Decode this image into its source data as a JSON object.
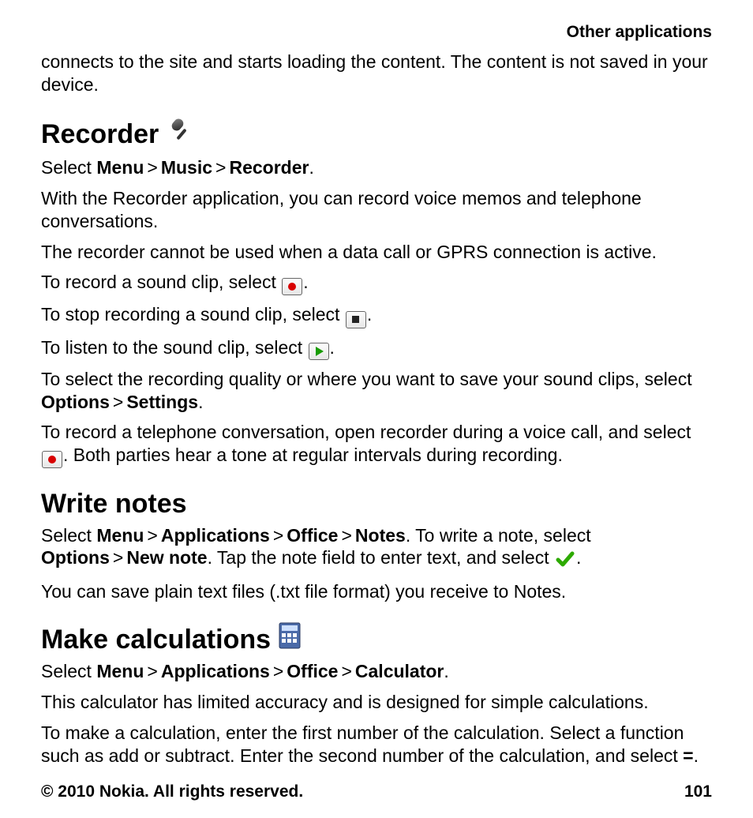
{
  "header": {
    "section": "Other applications"
  },
  "intro": "connects to the site and starts loading the content. The content is not saved in your device.",
  "recorder": {
    "heading": "Recorder",
    "nav": {
      "prefix": "Select ",
      "p1": "Menu",
      "p2": "Music",
      "p3": "Recorder",
      "suffix": "."
    },
    "p1": "With the Recorder application, you can record voice memos and telephone conversations.",
    "p2": "The recorder cannot be used when a data call or GPRS connection is active.",
    "rec_pre": "To record a sound clip, select ",
    "stop_pre": "To stop recording a sound clip, select ",
    "play_pre": "To listen to the sound clip, select ",
    "dot": ".",
    "settings_pre": "To select the recording quality or where you want to save your sound clips, select ",
    "options": "Options",
    "settings": "Settings",
    "call_pre": "To record a telephone conversation, open recorder during a voice call, and select ",
    "call_post": ". Both parties hear a tone at regular intervals during recording."
  },
  "notes": {
    "heading": "Write notes",
    "nav": {
      "prefix": "Select ",
      "p1": "Menu",
      "p2": "Applications",
      "p3": "Office",
      "p4": "Notes"
    },
    "after_nav": ". To write a note, select ",
    "options": "Options",
    "new_note": "New note",
    "after_new": ". Tap the note field to enter text, and select ",
    "dot": ".",
    "p2": "You can save plain text files (.txt file format) you receive to Notes."
  },
  "calc": {
    "heading": "Make calculations",
    "nav": {
      "prefix": "Select ",
      "p1": "Menu",
      "p2": "Applications",
      "p3": "Office",
      "p4": "Calculator",
      "suffix": "."
    },
    "p1": "This calculator has limited accuracy and is designed for simple calculations.",
    "p2_pre": "To make a calculation, enter the first number of the calculation. Select a function such as add or subtract. Enter the second number of the calculation, and select ",
    "equals": "=",
    "p2_post": "."
  },
  "footer": {
    "copyright": "© 2010 Nokia. All rights reserved.",
    "page": "101"
  },
  "gt": ">"
}
